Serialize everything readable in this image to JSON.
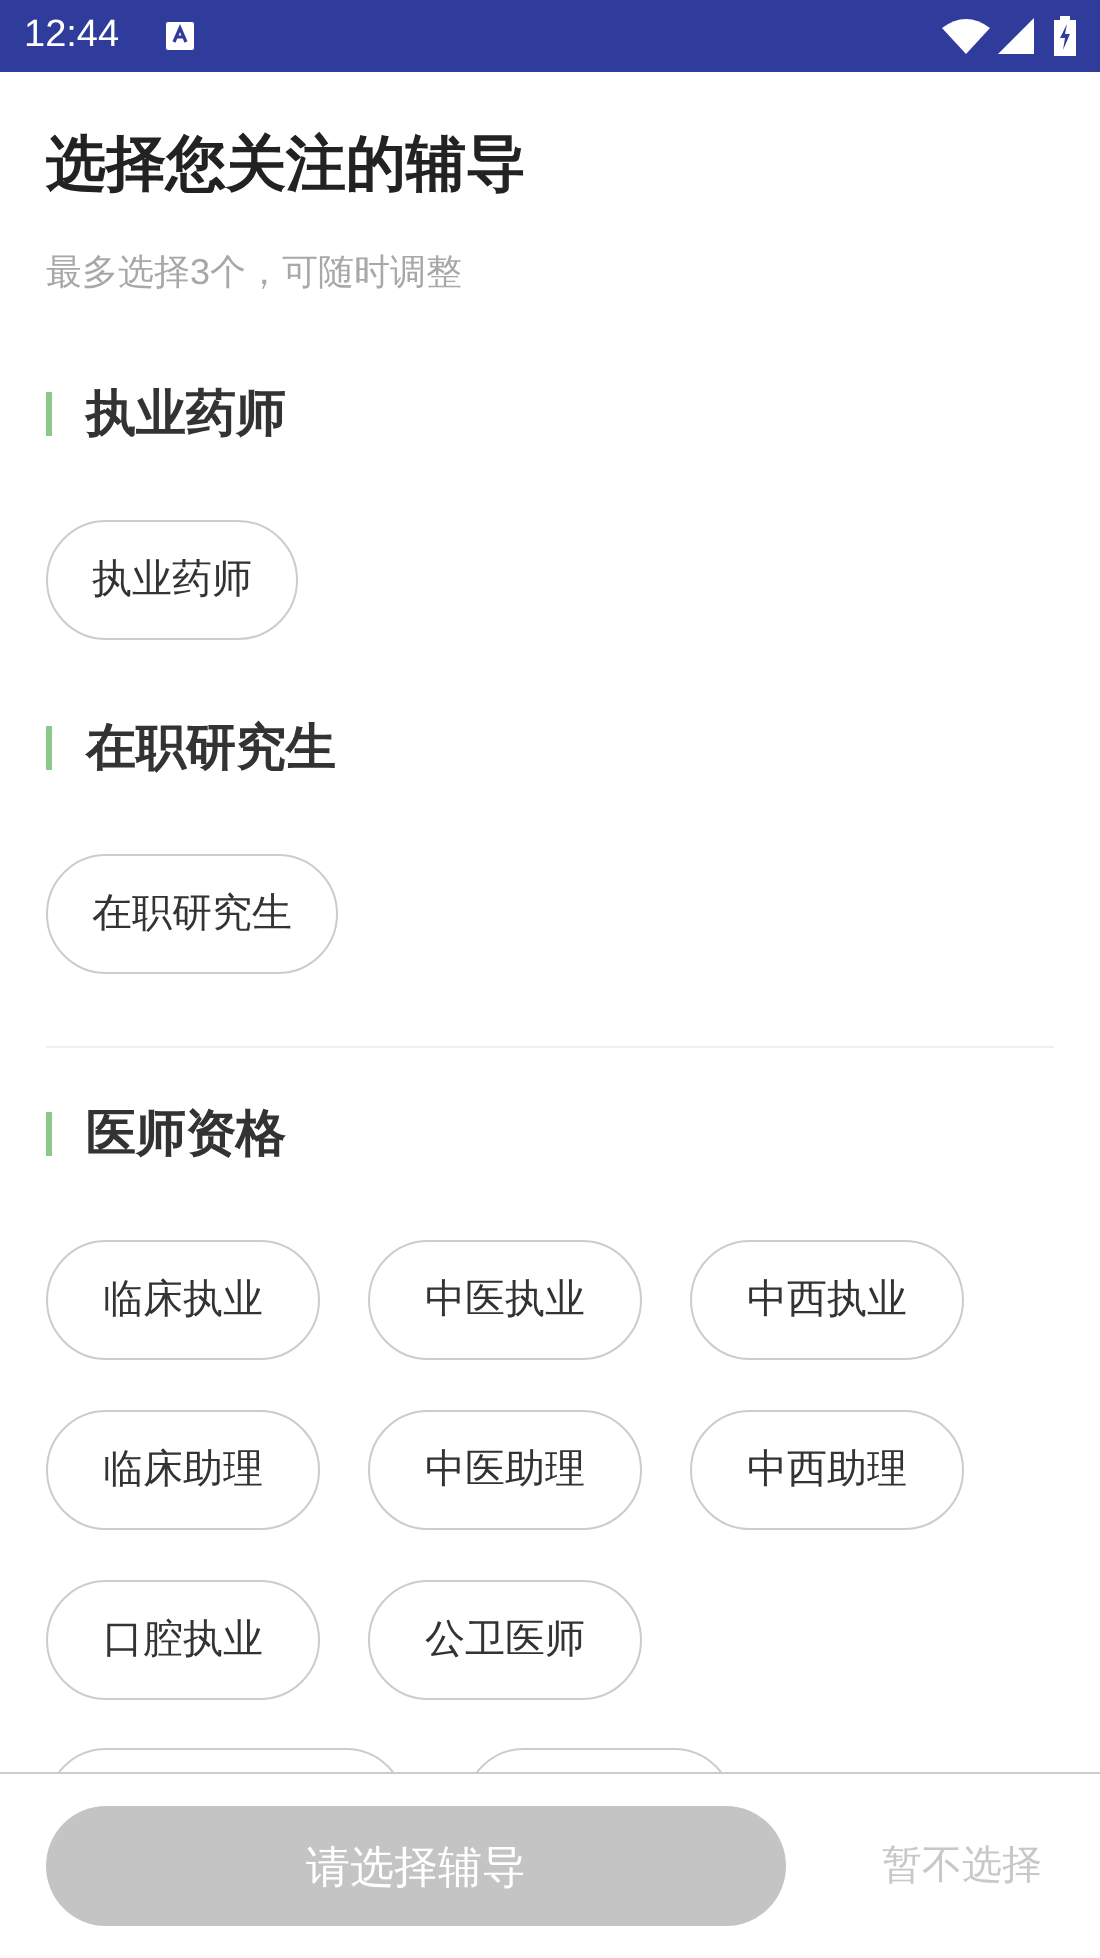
{
  "status_bar": {
    "time": "12:44"
  },
  "header": {
    "title": "选择您关注的辅导",
    "subtitle": "最多选择3个，可随时调整"
  },
  "sections": [
    {
      "title": "执业药师",
      "divider_before": false,
      "options": [
        {
          "label": "执业药师",
          "selected": false
        }
      ]
    },
    {
      "title": "在职研究生",
      "divider_before": false,
      "options": [
        {
          "label": "在职研究生",
          "selected": false
        }
      ]
    },
    {
      "title": "医师资格",
      "divider_before": true,
      "options": [
        {
          "label": "临床执业",
          "selected": false
        },
        {
          "label": "中医执业",
          "selected": false
        },
        {
          "label": "中西执业",
          "selected": false
        },
        {
          "label": "临床助理",
          "selected": false
        },
        {
          "label": "中医助理",
          "selected": false
        },
        {
          "label": "中西助理",
          "selected": false
        },
        {
          "label": "口腔执业",
          "selected": false
        },
        {
          "label": "公卫医师",
          "selected": false
        }
      ]
    }
  ],
  "footer": {
    "confirm_button": {
      "label": "请选择辅导",
      "disabled": true
    },
    "skip_link": "暂不选择"
  }
}
